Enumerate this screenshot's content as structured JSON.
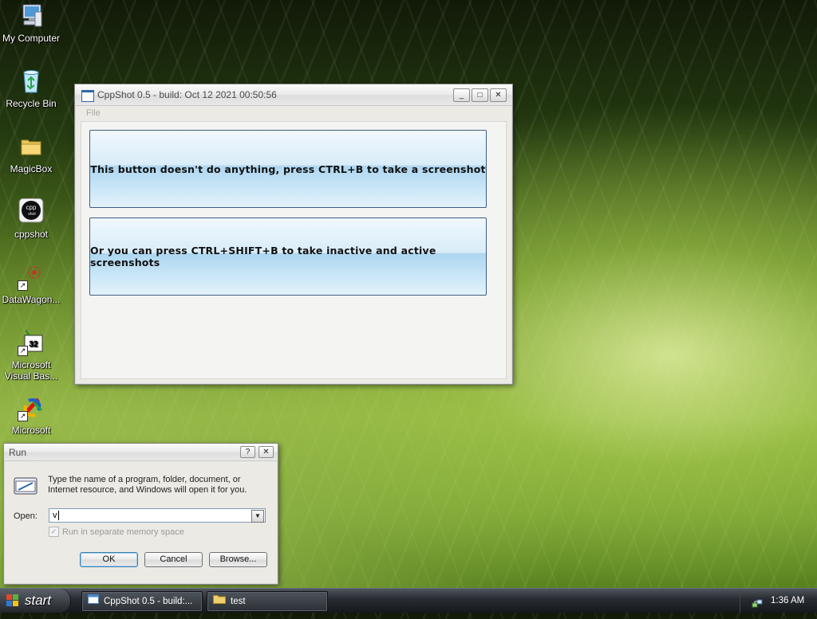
{
  "desktop": {
    "icons": [
      {
        "label": "My Computer",
        "icon": "computer-icon"
      },
      {
        "label": "Recycle Bin",
        "icon": "recycle-bin-icon"
      },
      {
        "label": "MagicBox",
        "icon": "folder-icon"
      },
      {
        "label": "cppshot",
        "icon": "cppshot-icon"
      },
      {
        "label": "DataWagon...",
        "icon": "datawagon-icon"
      },
      {
        "label": "Microsoft Visual Bas...",
        "icon": "visual-basic-icon"
      },
      {
        "label": "Microsoft Visual C...",
        "icon": "visual-c-icon"
      }
    ]
  },
  "cppshot_window": {
    "title": "CppShot 0.5 - build: Oct 12 2021 00:50:56",
    "menu": [
      "File"
    ],
    "button1": "This button doesn't do anything, press CTRL+B to take a screenshot",
    "button2": "Or you can press CTRL+SHIFT+B to take inactive and active screenshots",
    "controls": {
      "minimize": "_",
      "maximize": "□",
      "close": "✕"
    }
  },
  "run_dialog": {
    "title": "Run",
    "help": "?",
    "close": "✕",
    "description": "Type the name of a program, folder, document, or Internet resource, and Windows will open it for you.",
    "open_label": "Open:",
    "open_value": "v",
    "separate_memory_label": "Run in separate memory space",
    "separate_memory_checked": true,
    "ok": "OK",
    "cancel": "Cancel",
    "browse": "Browse..."
  },
  "taskbar": {
    "start_label": "start",
    "tasks": [
      {
        "label": "CppShot 0.5 - build:...",
        "icon": "window-icon"
      },
      {
        "label": "test",
        "icon": "folder-icon"
      }
    ],
    "clock": "1:36 AM",
    "tray_icon": "network-icon"
  }
}
